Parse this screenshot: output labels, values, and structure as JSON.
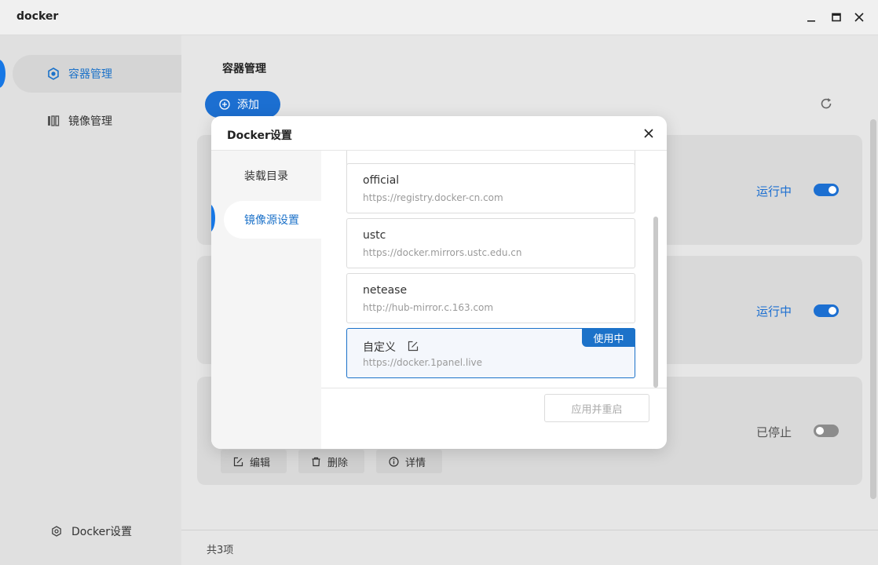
{
  "window": {
    "title": "docker"
  },
  "sidebar": {
    "items": [
      {
        "label": "容器管理",
        "icon": "container-icon"
      },
      {
        "label": "镜像管理",
        "icon": "image-icon"
      }
    ],
    "footer_label": "Docker设置"
  },
  "main": {
    "title": "容器管理",
    "add_label": "添加",
    "cards": [
      {
        "status": "运行中",
        "on": true
      },
      {
        "status": "运行中",
        "on": true
      },
      {
        "status": "已停止",
        "on": false
      }
    ],
    "actions": {
      "edit": "编辑",
      "delete": "删除",
      "detail": "详情"
    },
    "footer_count": "共3项"
  },
  "modal": {
    "title": "Docker设置",
    "tabs": [
      {
        "label": "装载目录"
      },
      {
        "label": "镜像源设置"
      }
    ],
    "mirrors": [
      {
        "name": "official",
        "url": "https://registry.docker-cn.com"
      },
      {
        "name": "ustc",
        "url": "https://docker.mirrors.ustc.edu.cn"
      },
      {
        "name": "netease",
        "url": "http://hub-mirror.c.163.com"
      },
      {
        "name": "自定义",
        "url": "https://docker.1panel.live",
        "badge": "使用中"
      }
    ],
    "apply_label": "应用并重启"
  },
  "colors": {
    "accent": "#1c72c9",
    "toggle_on": "#1c6fd1",
    "toggle_off": "#8c8c8c"
  }
}
